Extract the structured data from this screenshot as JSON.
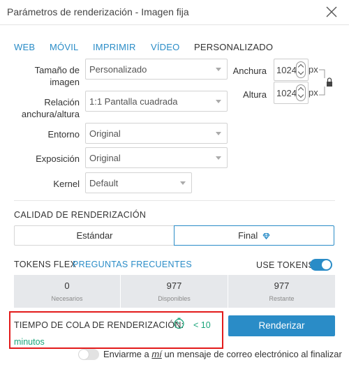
{
  "window": {
    "title": "Parámetros de renderización - Imagen fija",
    "close_icon": "close-icon"
  },
  "tabs": [
    {
      "label": "WEB",
      "active": false
    },
    {
      "label": "MÓVIL",
      "active": false
    },
    {
      "label": "IMPRIMIR",
      "active": false
    },
    {
      "label": "VÍDEO",
      "active": false
    },
    {
      "label": "PERSONALIZADO",
      "active": true
    }
  ],
  "form": {
    "image_size": {
      "label_line1": "Tamaño de",
      "label_line2": "imagen",
      "value": "Personalizado"
    },
    "aspect": {
      "label_line1": "Relación",
      "label_line2": "anchura/altura",
      "value": "1:1 Pantalla cuadrada"
    },
    "environment": {
      "label": "Entorno",
      "value": "Original"
    },
    "exposure": {
      "label": "Exposición",
      "value": "Original"
    },
    "kernel": {
      "label": "Kernel",
      "value": "Default"
    },
    "width": {
      "label": "Anchura",
      "value": "1024",
      "unit": "px"
    },
    "height": {
      "label": "Altura",
      "value": "1024",
      "unit": "px"
    },
    "lock_icon": "lock-icon"
  },
  "quality": {
    "label": "CALIDAD DE RENDERIZACIÓN",
    "options": [
      {
        "label": "Estándar",
        "selected": false
      },
      {
        "label": "Final",
        "selected": true,
        "icon": "diamond-icon"
      }
    ]
  },
  "tokens": {
    "label": "TOKENS FLEX",
    "faq_link": "PREGUNTAS FRECUENTES",
    "use_tokens_label": "USE TOKENS",
    "use_tokens_on": true,
    "cells": [
      {
        "value": "0",
        "caption": "Necesarios"
      },
      {
        "value": "977",
        "caption": "Disponibles"
      },
      {
        "value": "977",
        "caption": "Restante"
      }
    ]
  },
  "queue": {
    "label": "TIEMPO DE COLA DE RENDERIZACIÓN:",
    "icon": "timer-icon",
    "value": "< 10",
    "unit": "minutos"
  },
  "render_button": "Renderizar",
  "email_notify": {
    "text_before": "Enviarme a",
    "text_emph": "mí",
    "text_after": "un mensaje de correo electrónico al finalizar",
    "enabled": false
  },
  "colors": {
    "accent": "#2a8cc7",
    "highlight_box": "#e31b1b",
    "token_bg": "#e6e8eb"
  }
}
